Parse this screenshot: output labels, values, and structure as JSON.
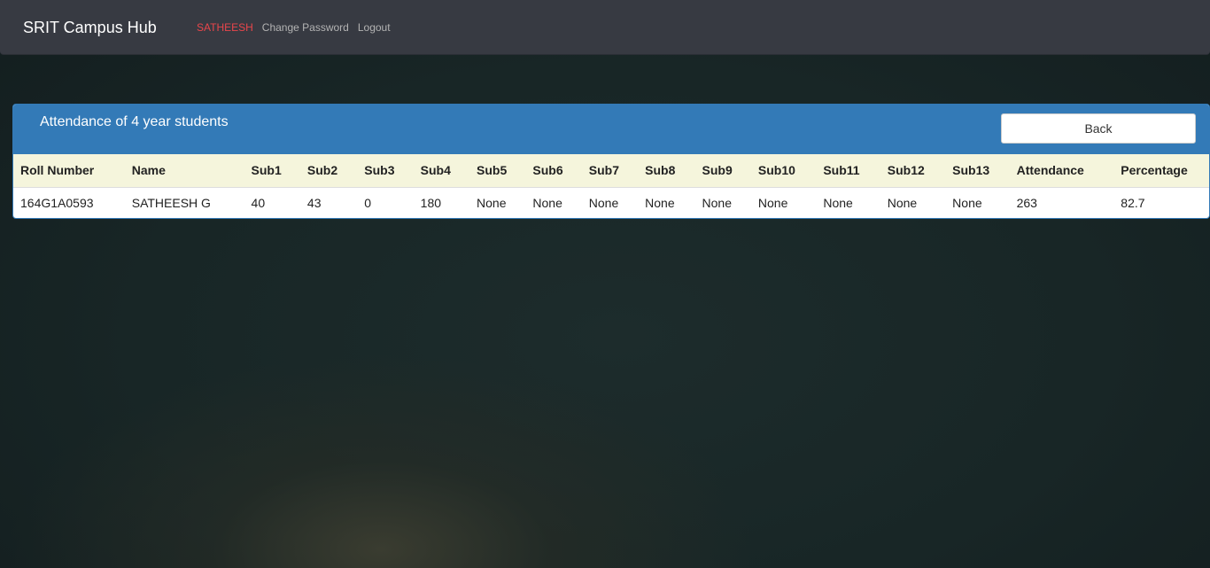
{
  "navbar": {
    "brand": "SRIT Campus Hub",
    "user": "SATHEESH",
    "change_password": "Change Password",
    "logout": "Logout"
  },
  "panel": {
    "title": "Attendance of 4 year students",
    "back_label": "Back"
  },
  "table": {
    "headers": [
      "Roll Number",
      "Name",
      "Sub1",
      "Sub2",
      "Sub3",
      "Sub4",
      "Sub5",
      "Sub6",
      "Sub7",
      "Sub8",
      "Sub9",
      "Sub10",
      "Sub11",
      "Sub12",
      "Sub13",
      "Attendance",
      "Percentage"
    ],
    "rows": [
      [
        "164G1A0593",
        "SATHEESH G",
        "40",
        "43",
        "0",
        "180",
        "None",
        "None",
        "None",
        "None",
        "None",
        "None",
        "None",
        "None",
        "None",
        "263",
        "82.7"
      ]
    ]
  },
  "colors": {
    "navbar_bg": "#373a42",
    "user_link": "#e8464b",
    "panel_heading": "#337ab7",
    "table_header_bg": "#f5f5dc"
  }
}
